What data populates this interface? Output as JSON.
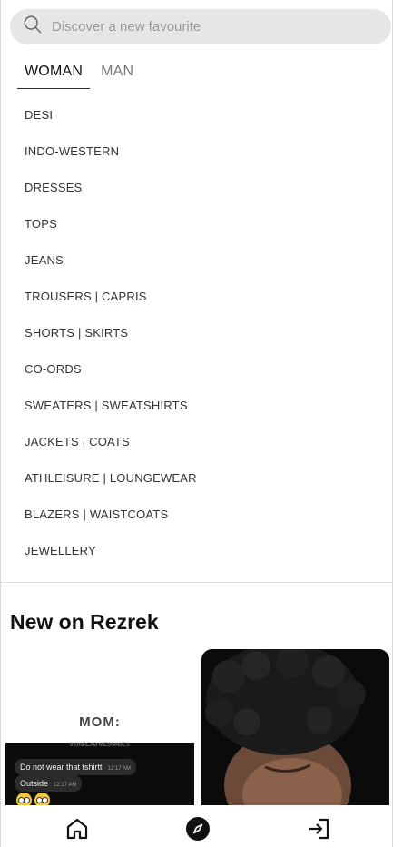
{
  "search": {
    "placeholder": "Discover a new favourite",
    "value": ""
  },
  "tabs": [
    {
      "label": "WOMAN",
      "active": true
    },
    {
      "label": "MAN",
      "active": false
    }
  ],
  "categories": [
    "DESI",
    "INDO-WESTERN",
    "DRESSES",
    "TOPS",
    "JEANS",
    "TROUSERS | CAPRIS",
    "SHORTS | SKIRTS",
    "CO-ORDS",
    "SWEATERS | SWEATSHIRTS",
    "JACKETS | COATS",
    "ATHLEISURE | LOUNGEWEAR",
    "BLAZERS | WAISTCOATS",
    "JEWELLERY"
  ],
  "new_section": {
    "title": "New on Rezrek",
    "product1": {
      "brand_text": "MOM:",
      "unread_text": "2 UNREAD MESSAGES",
      "messages": [
        {
          "text": "Do not wear that tshirtt",
          "time": "12:17 AM"
        },
        {
          "text": "Outside",
          "time": "12:17 AM"
        }
      ]
    }
  },
  "bottom_nav": {
    "items": [
      {
        "name": "home",
        "icon": "home-icon"
      },
      {
        "name": "explore",
        "icon": "compass-icon"
      },
      {
        "name": "login",
        "icon": "login-icon"
      }
    ]
  },
  "colors": {
    "search_bg": "#e6e6e6",
    "text": "#222222",
    "accent": "#111111"
  }
}
